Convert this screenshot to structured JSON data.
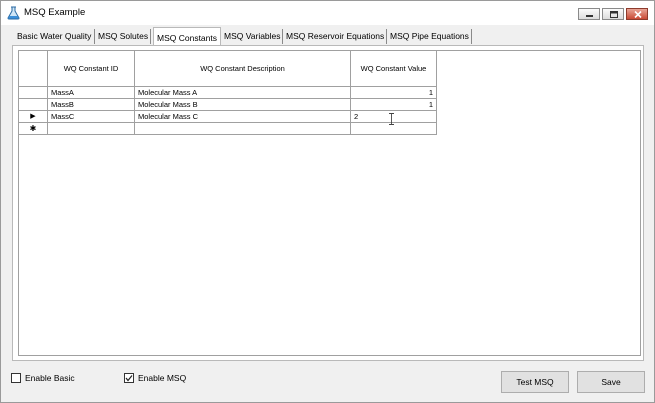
{
  "window": {
    "title": "MSQ Example"
  },
  "tabs": [
    {
      "label": "Basic Water Quality"
    },
    {
      "label": "MSQ Solutes"
    },
    {
      "label": "MSQ Constants",
      "active": true
    },
    {
      "label": "MSQ Variables"
    },
    {
      "label": "MSQ Reservoir Equations"
    },
    {
      "label": "MSQ Pipe Equations"
    }
  ],
  "grid": {
    "columns": [
      "WQ Constant ID",
      "WQ Constant Description",
      "WQ Constant Value"
    ],
    "rows": [
      {
        "id": "MassA",
        "description": "Molecular Mass A",
        "value": "1"
      },
      {
        "id": "MassB",
        "description": "Molecular Mass B",
        "value": "1"
      },
      {
        "id": "MassC",
        "description": "Molecular Mass C",
        "value": "2",
        "current": true
      }
    ],
    "current_row_marker": "▶",
    "new_row_marker": "✱"
  },
  "options": {
    "enable_basic": {
      "label": "Enable Basic",
      "checked": false
    },
    "enable_msq": {
      "label": "Enable MSQ",
      "checked": true
    }
  },
  "buttons": {
    "test": "Test MSQ",
    "save": "Save"
  },
  "colors": {
    "border": "#a0a0a0",
    "face": "#f0f0f0",
    "button": "#e1e1e1"
  }
}
